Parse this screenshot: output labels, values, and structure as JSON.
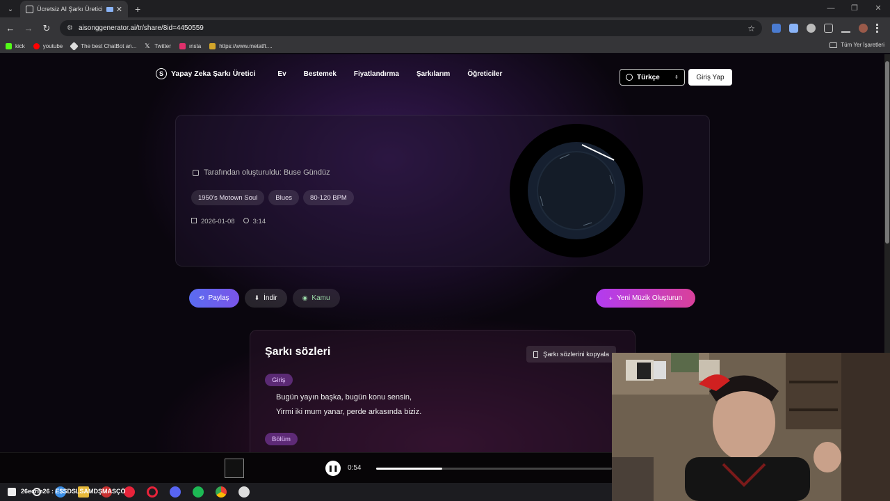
{
  "browser": {
    "tab_title": "Ücretsiz AI Şarkı Üretici - AI",
    "url": "aisonggenerator.ai/tr/share/8id=4450559",
    "bookmarks": [
      {
        "label": "kick",
        "color": "#53fc18"
      },
      {
        "label": "youtube",
        "color": "#ff0000"
      },
      {
        "label": "The best ChatBot an...",
        "color": "#dddddd"
      },
      {
        "label": "Twitter",
        "color": "#ffffff"
      },
      {
        "label": "ınsta",
        "color": "#e1306c"
      },
      {
        "label": "https://www.metatft....",
        "color": "#d4a62a"
      }
    ],
    "all_bookmarks": "Tüm Yer İşaretleri"
  },
  "site": {
    "logo": "Yapay Zeka Şarkı Üretici",
    "logo_letter": "S",
    "menu": [
      "Ev",
      "Bestemek",
      "Fiyatlandırma",
      "Şarkılarım",
      "Öğreticiler"
    ],
    "language": "Türkçe",
    "login": "Giriş Yap"
  },
  "song": {
    "creator": "Tarafından oluşturuldu: Buse Gündüz",
    "tags": [
      "1950's Motown Soul",
      "Blues",
      "80-120 BPM"
    ],
    "date": "2026-01-08",
    "duration": "3:14"
  },
  "actions": {
    "share": "Paylaş",
    "download": "İndir",
    "public": "Kamu",
    "new_music": "Yeni Müzik Oluşturun"
  },
  "lyrics": {
    "title": "Şarkı sözleri",
    "copy": "Şarkı sözlerini kopyala",
    "section1": "Giriş",
    "line1": "Bugün yayın başka, bugün konu sensin,",
    "line2": "Yirmi iki mum yanar, perde arkasında biziz.",
    "section2": "Bölüm"
  },
  "player": {
    "current_time": "0:54",
    "progress": 0.28
  },
  "taskbar": {
    "text": "26ecrin26 : E$SDSLSAMDŞMASÇÖ"
  },
  "colors": {
    "accent_purple": "#b23cf0",
    "accent_pink": "#d9409a",
    "share_blue": "#5a6cf0"
  }
}
